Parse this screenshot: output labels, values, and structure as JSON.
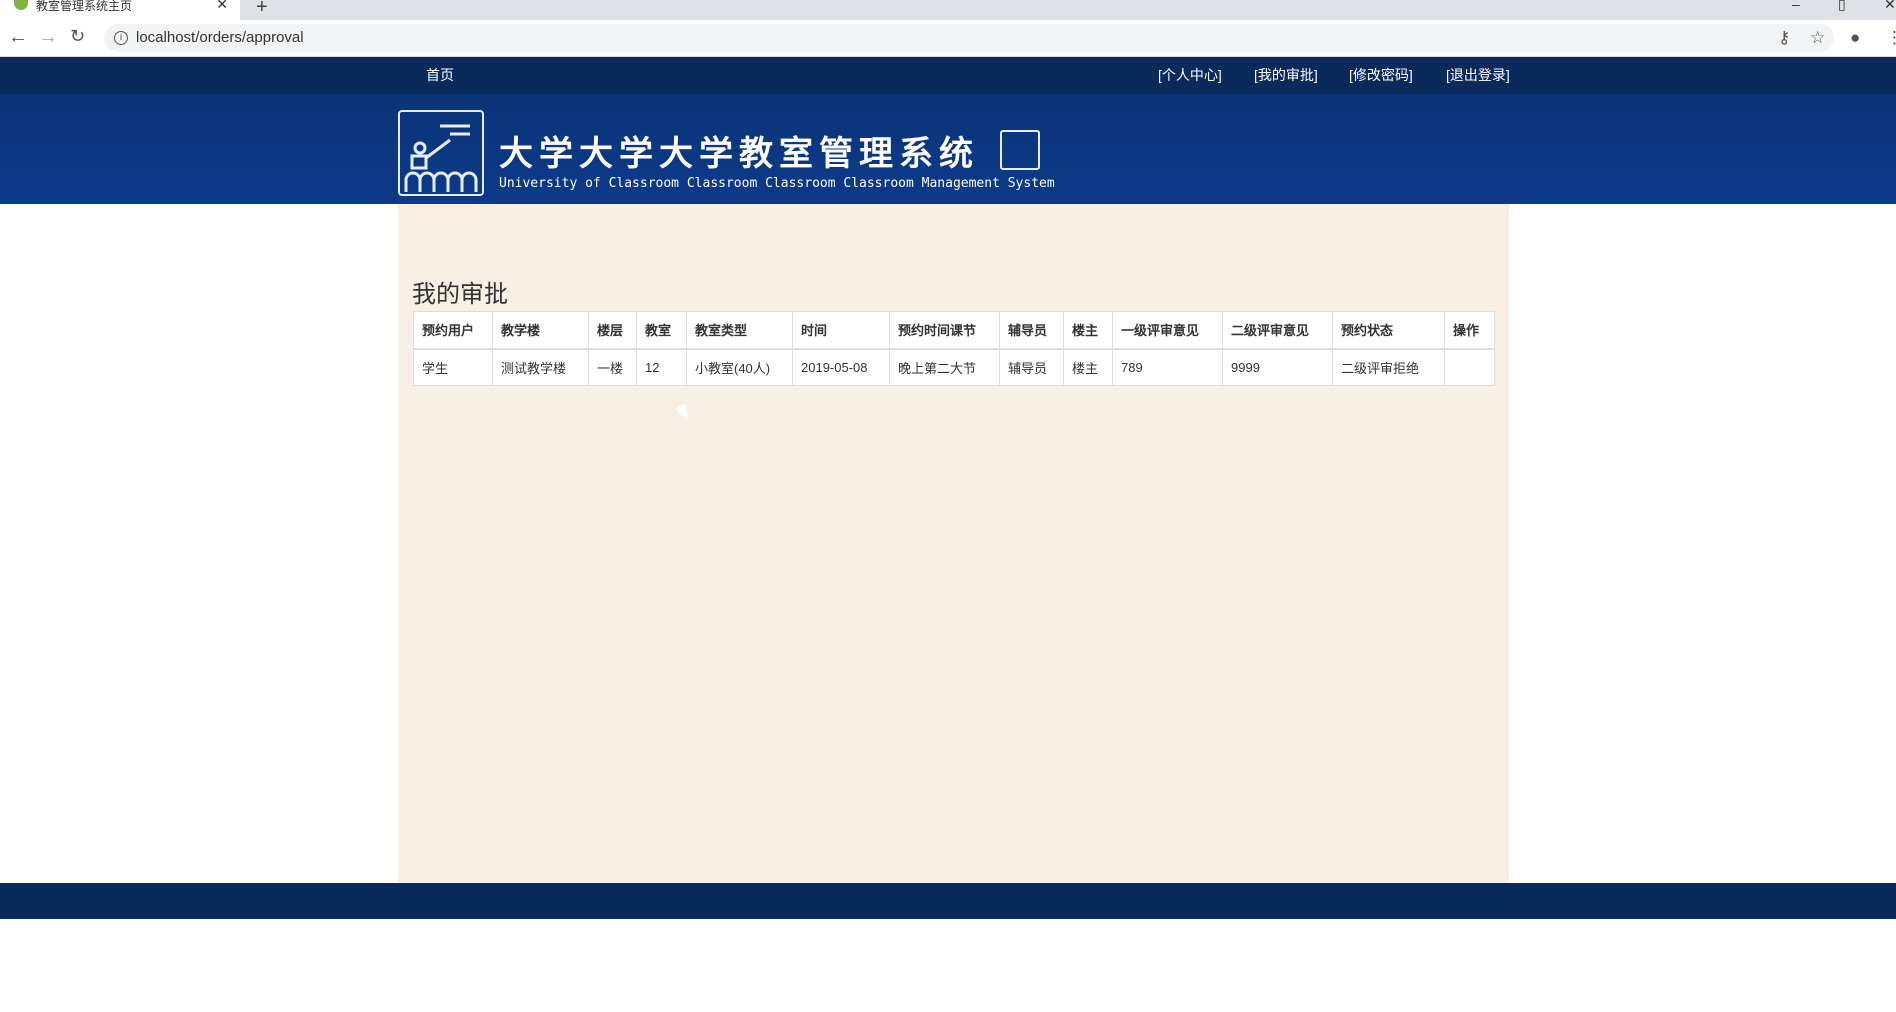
{
  "browser": {
    "tab_title": "教室管理系统主页",
    "url": "localhost/orders/approval"
  },
  "nav": {
    "home": "首页",
    "items": [
      "[个人中心]",
      "[我的审批]",
      "[修改密码]",
      "[退出登录]"
    ]
  },
  "banner": {
    "title": "大学大学大学教室管理系统",
    "subtitle": "University of Classroom Classroom Classroom Classroom Management System"
  },
  "page": {
    "title": "我的审批"
  },
  "table": {
    "headers": [
      "预约用户",
      "教学楼",
      "楼层",
      "教室",
      "教室类型",
      "时间",
      "预约时间课节",
      "辅导员",
      "楼主",
      "一级评审意见",
      "二级评审意见",
      "预约状态",
      "操作"
    ],
    "rows": [
      [
        "学生",
        "测试教学楼",
        "一楼",
        "12",
        "小教室(40人)",
        "2019-05-08",
        "晚上第二大节",
        "辅导员",
        "楼主",
        "789",
        "9999",
        "二级评审拒绝",
        ""
      ]
    ]
  }
}
